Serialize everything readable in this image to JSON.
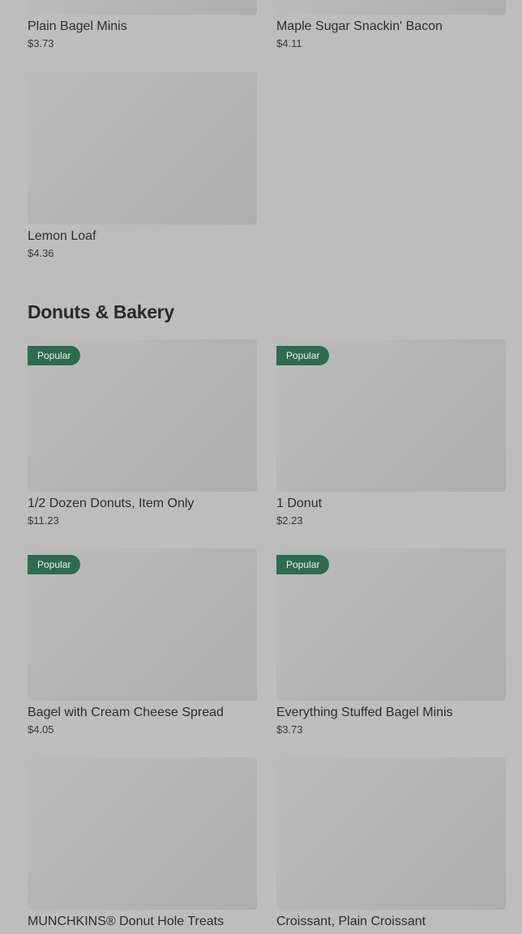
{
  "top_items": [
    {
      "name": "Plain Bagel Minis",
      "price": "$3.73"
    },
    {
      "name": "Maple Sugar Snackin' Bacon",
      "price": "$4.11"
    },
    {
      "name": "Lemon Loaf",
      "price": "$4.36"
    }
  ],
  "section": {
    "title": "Donuts & Bakery",
    "badge_label": "Popular",
    "items": [
      {
        "name": "1/2 Dozen Donuts, Item Only",
        "price": "$11.23"
      },
      {
        "name": "1 Donut",
        "price": "$2.23"
      },
      {
        "name": "Bagel with Cream Cheese Spread",
        "price": "$4.05"
      },
      {
        "name": "Everything Stuffed Bagel Minis",
        "price": "$3.73"
      },
      {
        "name": "MUNCHKINS® Donut Hole Treats"
      },
      {
        "name": "Croissant, Plain Croissant"
      }
    ]
  }
}
